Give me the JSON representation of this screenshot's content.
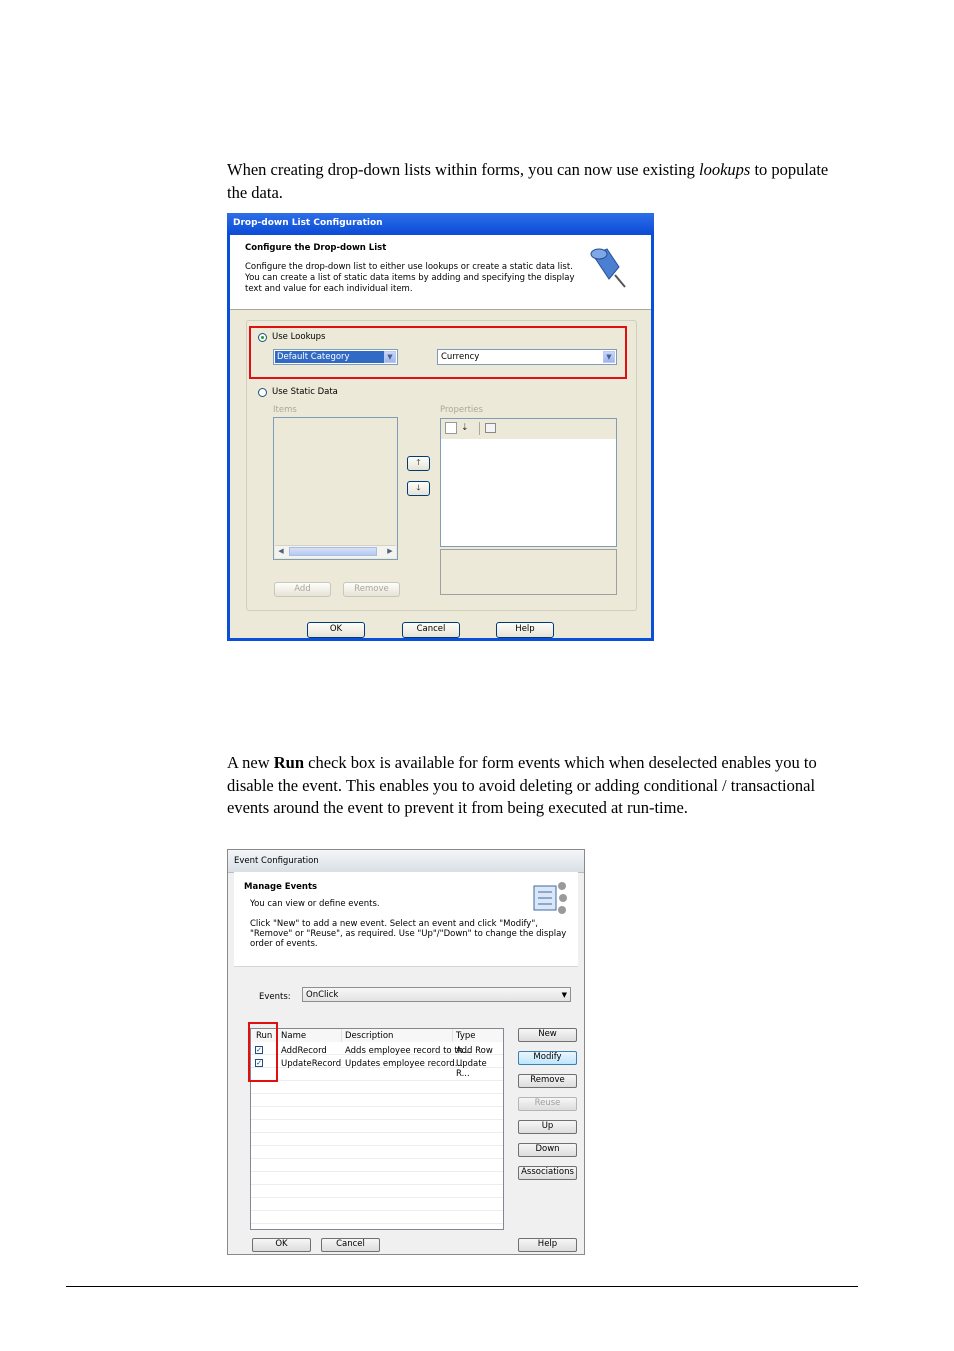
{
  "para1": {
    "before": "When creating drop-down lists within forms, you can now use existing ",
    "italic": "lookups",
    "after": " to populate the data."
  },
  "dialog1": {
    "title": "Drop-down List Configuration",
    "heading": "Configure the Drop-down List",
    "description": "Configure the drop-down list to either use lookups or create a static data list. You can create a list of static data items by adding and specifying the display text and value for each individual item.",
    "use_lookups_label": "Use Lookups",
    "category_value": "Default Category",
    "lookup_value": "Currency",
    "use_static_label": "Use Static Data",
    "items_label": "Items",
    "properties_label": "Properties",
    "add_label": "Add",
    "remove_label": "Remove",
    "ok_label": "OK",
    "cancel_label": "Cancel",
    "help_label": "Help"
  },
  "para2": {
    "before": "A new ",
    "bold": "Run",
    "after": " check box is available for form events which when deselected enables you to disable the event. This enables you to avoid deleting or adding conditional / transactional events around the event to prevent it from being executed at run-time."
  },
  "dialog2": {
    "title": "Event Configuration",
    "heading": "Manage Events",
    "subheading": "You can view or define events.",
    "instructions": "Click \"New\" to add a new event. Select an event and click \"Modify\", \"Remove\" or \"Reuse\", as required. Use \"Up\"/\"Down\" to change the display order of events.",
    "events_label": "Events:",
    "events_value": "OnClick",
    "columns": [
      "Run",
      "Name",
      "Description",
      "Type"
    ],
    "rows": [
      {
        "run": "✓",
        "name": "AddRecord",
        "description": "Adds employee record to th...",
        "type": "Add Row"
      },
      {
        "run": "✓",
        "name": "UpdateRecord",
        "description": "Updates employee record...",
        "type": "Update R..."
      }
    ],
    "buttons": {
      "new": "New",
      "modify": "Modify",
      "remove": "Remove",
      "reuse": "Reuse",
      "up": "Up",
      "down": "Down",
      "associations": "Associations",
      "ok": "OK",
      "cancel": "Cancel",
      "help": "Help"
    }
  },
  "colors": {
    "highlight": "#e01010",
    "xp_title": "#0a4fd8"
  }
}
